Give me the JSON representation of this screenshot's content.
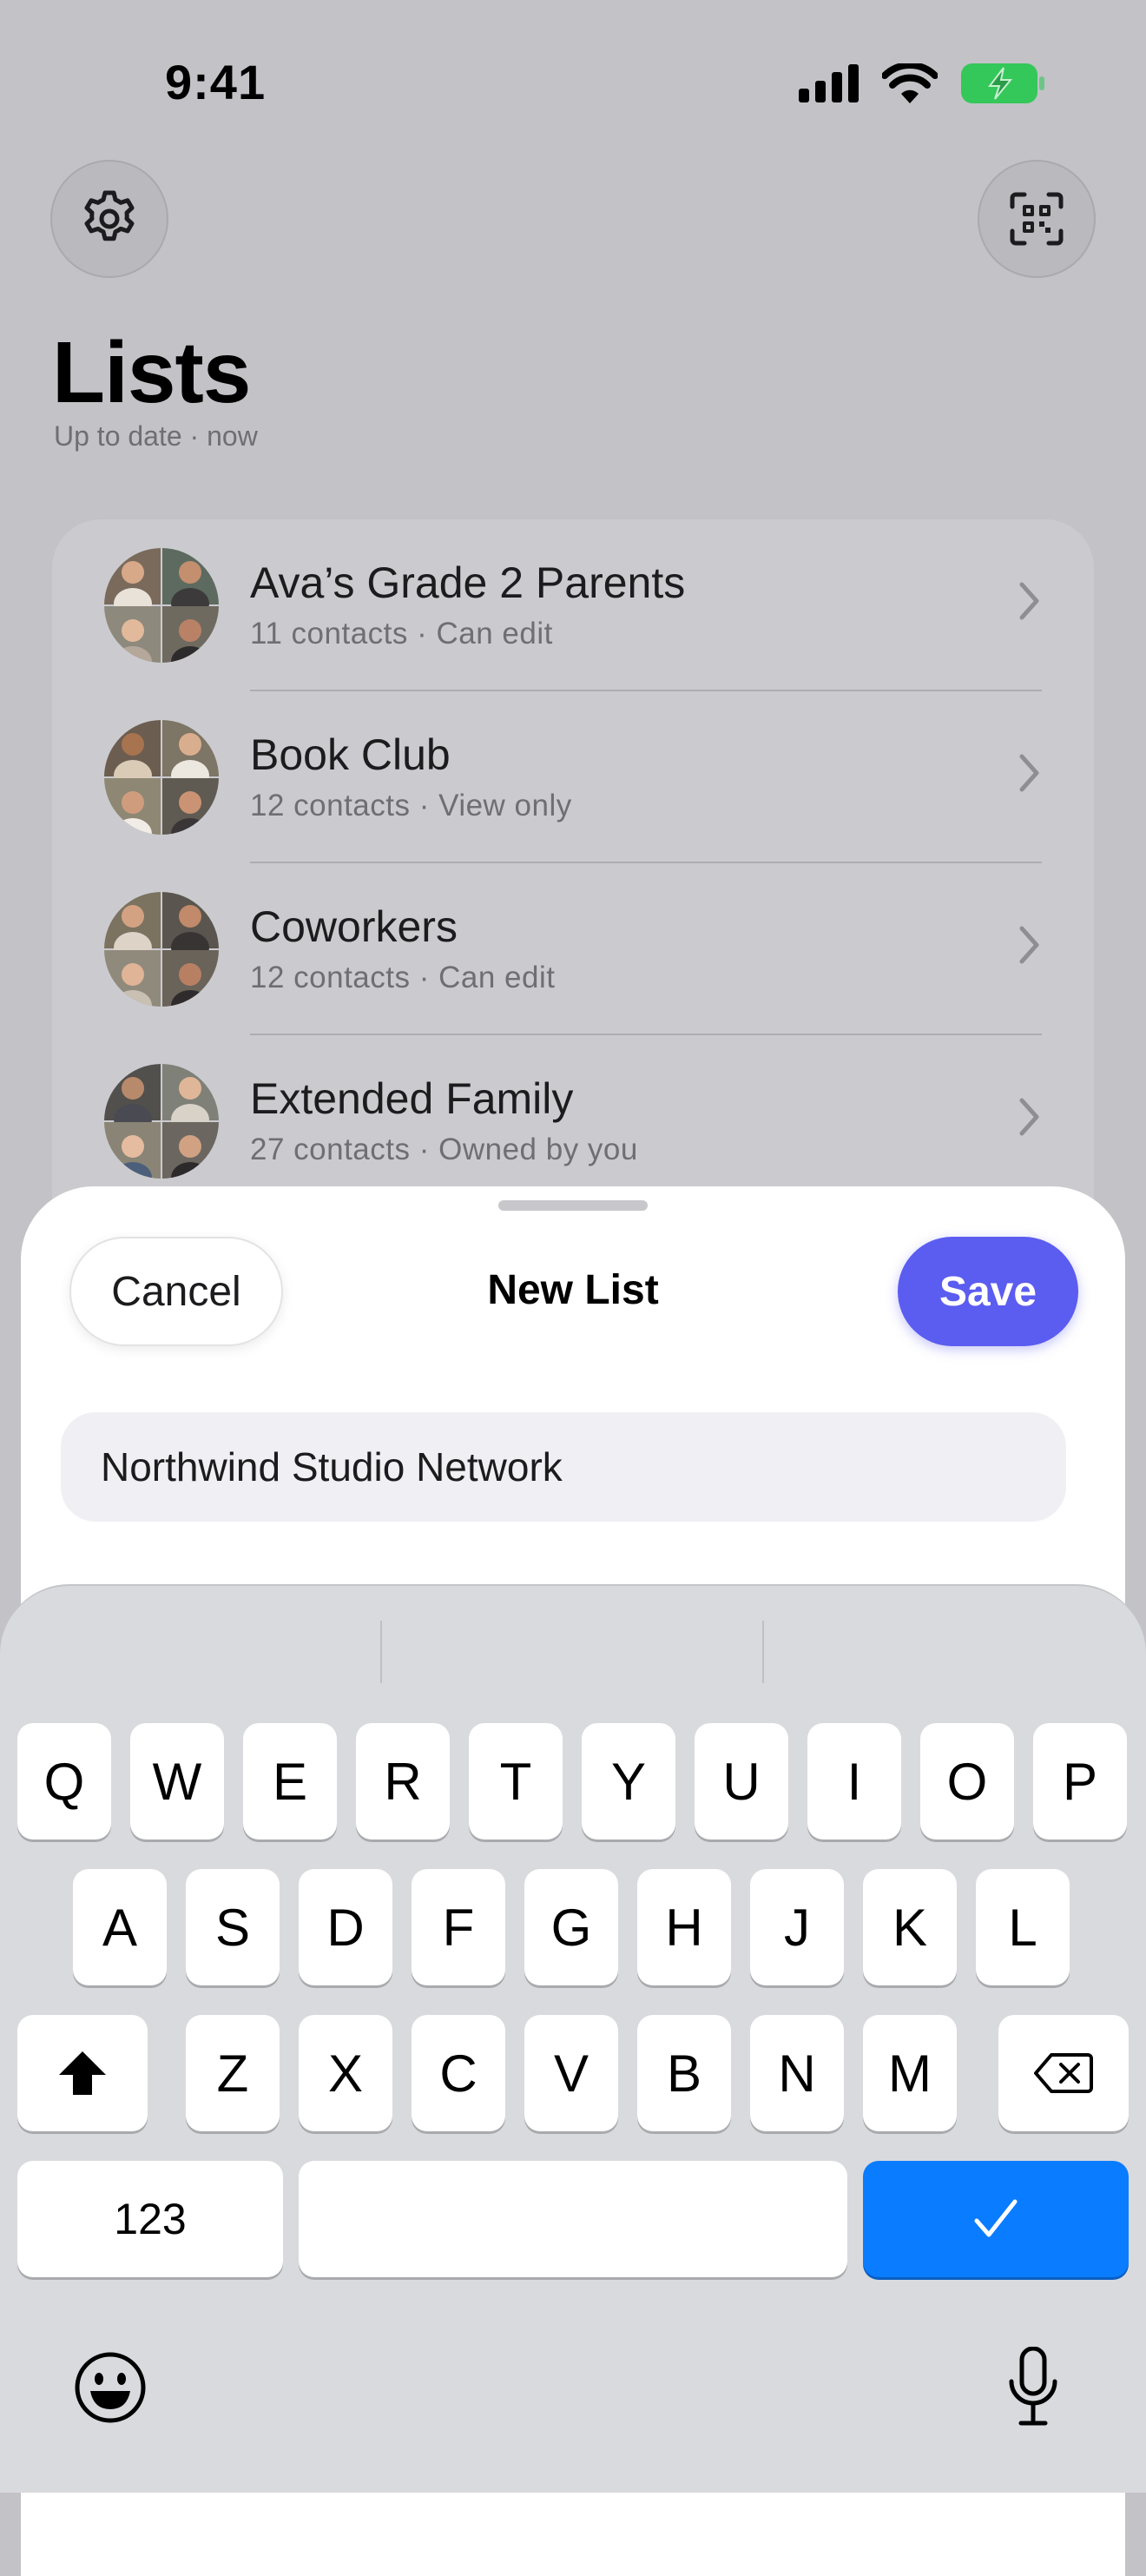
{
  "status_bar": {
    "time": "9:41"
  },
  "header": {
    "settings_icon": "gear-icon",
    "scan_icon": "qr-scan-icon",
    "title": "Lists",
    "subtitle": "Up to date · now"
  },
  "lists": [
    {
      "name": "Ava’s Grade 2 Parents",
      "detail": "11 contacts · Can edit"
    },
    {
      "name": "Book Club",
      "detail": "12 contacts · View only"
    },
    {
      "name": "Coworkers",
      "detail": "12 contacts · Can edit"
    },
    {
      "name": "Extended Family",
      "detail": "27 contacts · Owned by you"
    }
  ],
  "sheet": {
    "cancel_label": "Cancel",
    "title": "New List",
    "save_label": "Save",
    "name_value": "Northwind Studio Network",
    "accent_color": "#5b5cf0"
  },
  "keyboard": {
    "row1": [
      "Q",
      "W",
      "E",
      "R",
      "T",
      "Y",
      "U",
      "I",
      "O",
      "P"
    ],
    "row2": [
      "A",
      "S",
      "D",
      "F",
      "G",
      "H",
      "J",
      "K",
      "L"
    ],
    "row3": [
      "Z",
      "X",
      "C",
      "V",
      "B",
      "N",
      "M"
    ],
    "numbers_label": "123",
    "done_color": "#0a7cff"
  }
}
